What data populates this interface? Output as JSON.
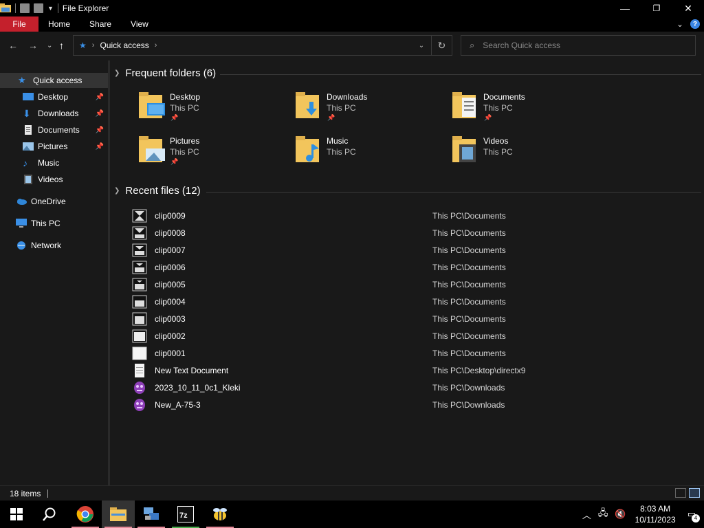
{
  "window": {
    "title": "File Explorer",
    "controls": {
      "minimize": "—",
      "maximize": "❐",
      "close": "✕"
    }
  },
  "ribbon": {
    "tabs": [
      "File",
      "Home",
      "Share",
      "View"
    ],
    "help": "?",
    "collapse": "⌄"
  },
  "nav": {
    "back": "←",
    "forward": "→",
    "recent": "⌄",
    "up": "↑"
  },
  "address": {
    "crumb": "Quick access",
    "sep_icon": "›",
    "dropdown": "⌄",
    "refresh": "↻"
  },
  "search": {
    "placeholder": "Search Quick access",
    "icon": "⌕"
  },
  "sidebar": {
    "items": [
      {
        "label": "Quick access",
        "icon": "star-icon",
        "pinned": false,
        "selected": true
      },
      {
        "label": "Desktop",
        "icon": "desktop-icon",
        "pinned": true
      },
      {
        "label": "Downloads",
        "icon": "download-icon",
        "pinned": true
      },
      {
        "label": "Documents",
        "icon": "document-icon",
        "pinned": true
      },
      {
        "label": "Pictures",
        "icon": "pictures-icon",
        "pinned": true
      },
      {
        "label": "Music",
        "icon": "music-icon",
        "pinned": false
      },
      {
        "label": "Videos",
        "icon": "video-icon",
        "pinned": false
      },
      {
        "label": "OneDrive",
        "icon": "cloud-icon",
        "pinned": false
      },
      {
        "label": "This PC",
        "icon": "pc-icon",
        "pinned": false
      },
      {
        "label": "Network",
        "icon": "network-icon",
        "pinned": false
      }
    ]
  },
  "frequent": {
    "heading": "Frequent folders (6)",
    "folders": [
      {
        "name": "Desktop",
        "location": "This PC",
        "pinned": true
      },
      {
        "name": "Downloads",
        "location": "This PC",
        "pinned": true
      },
      {
        "name": "Documents",
        "location": "This PC",
        "pinned": true
      },
      {
        "name": "Pictures",
        "location": "This PC",
        "pinned": true
      },
      {
        "name": "Music",
        "location": "This PC",
        "pinned": false
      },
      {
        "name": "Videos",
        "location": "This PC",
        "pinned": false
      }
    ]
  },
  "recent": {
    "heading": "Recent files (12)",
    "files": [
      {
        "name": "clip0009",
        "path": "This PC\\Documents",
        "icon": "clip-icon"
      },
      {
        "name": "clip0008",
        "path": "This PC\\Documents",
        "icon": "clip-icon"
      },
      {
        "name": "clip0007",
        "path": "This PC\\Documents",
        "icon": "clip-icon"
      },
      {
        "name": "clip0006",
        "path": "This PC\\Documents",
        "icon": "clip-icon"
      },
      {
        "name": "clip0005",
        "path": "This PC\\Documents",
        "icon": "clip-icon"
      },
      {
        "name": "clip0004",
        "path": "This PC\\Documents",
        "icon": "clip-icon"
      },
      {
        "name": "clip0003",
        "path": "This PC\\Documents",
        "icon": "clip-icon"
      },
      {
        "name": "clip0002",
        "path": "This PC\\Documents",
        "icon": "clip-icon"
      },
      {
        "name": "clip0001",
        "path": "This PC\\Documents",
        "icon": "clip-icon"
      },
      {
        "name": "New Text Document",
        "path": "This PC\\Desktop\\directx9",
        "icon": "text-file-icon"
      },
      {
        "name": "2023_10_11_0c1_Kleki",
        "path": "This PC\\Downloads",
        "icon": "image-file-icon"
      },
      {
        "name": "New_A-75-3",
        "path": "This PC\\Downloads",
        "icon": "image-file-icon"
      }
    ]
  },
  "status": {
    "count": "18 items"
  },
  "taskbar": {
    "time": "8:03 AM",
    "date": "10/11/2023",
    "notification_count": "4",
    "apps": [
      "start-button",
      "search-button",
      "chrome-app",
      "file-explorer-app",
      "network-app",
      "7zip-app",
      "bee-app"
    ]
  },
  "colors": {
    "accent_file_tab": "#c4202c",
    "background": "#191919",
    "folder_yellow": "#f2c55c",
    "selection": "#343434"
  }
}
